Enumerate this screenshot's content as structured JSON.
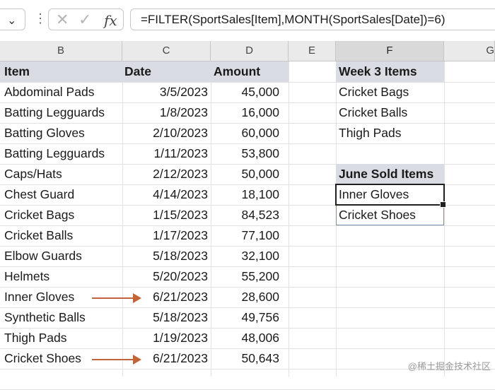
{
  "formula_bar": {
    "namebox_chevron": "⌄",
    "cancel_icon": "✕",
    "enter_icon": "✓",
    "fx_label": "fx",
    "formula": "=FILTER(SportSales[Item],MONTH(SportSales[Date])=6)"
  },
  "columns": [
    "B",
    "C",
    "D",
    "E",
    "F",
    "G"
  ],
  "table": {
    "headers": {
      "item": "Item",
      "date": "Date",
      "amount": "Amount"
    },
    "rows": [
      {
        "item": "Abdominal Pads",
        "date": "3/5/2023",
        "amount": "45,000"
      },
      {
        "item": "Batting Legguards",
        "date": "1/8/2023",
        "amount": "16,000"
      },
      {
        "item": "Batting Gloves",
        "date": "2/10/2023",
        "amount": "60,000"
      },
      {
        "item": "Batting Legguards",
        "date": "1/11/2023",
        "amount": "53,800"
      },
      {
        "item": "Caps/Hats",
        "date": "2/12/2023",
        "amount": "50,000"
      },
      {
        "item": "Chest Guard",
        "date": "4/14/2023",
        "amount": "18,100"
      },
      {
        "item": "Cricket Bags",
        "date": "1/15/2023",
        "amount": "84,523"
      },
      {
        "item": "Cricket Balls",
        "date": "1/17/2023",
        "amount": "77,100"
      },
      {
        "item": "Elbow Guards",
        "date": "5/18/2023",
        "amount": "32,100"
      },
      {
        "item": "Helmets",
        "date": "5/20/2023",
        "amount": "55,200"
      },
      {
        "item": "Inner Gloves",
        "date": "6/21/2023",
        "amount": "28,600"
      },
      {
        "item": "Synthetic Balls",
        "date": "5/18/2023",
        "amount": "49,756"
      },
      {
        "item": "Thigh Pads",
        "date": "1/19/2023",
        "amount": "48,006"
      },
      {
        "item": "Cricket Shoes",
        "date": "6/21/2023",
        "amount": "50,643"
      }
    ]
  },
  "week3": {
    "header": "Week 3 Items",
    "items": [
      "Cricket Bags",
      "Cricket Balls",
      "Thigh Pads"
    ]
  },
  "june": {
    "header": "June Sold Items",
    "items": [
      "Inner Gloves",
      "Cricket Shoes"
    ]
  },
  "watermark": "@稀土掘金技术社区",
  "colors": {
    "header_fill": "#d9dde3",
    "arrow": "#c0643a",
    "grid": "#e2e2e2"
  }
}
